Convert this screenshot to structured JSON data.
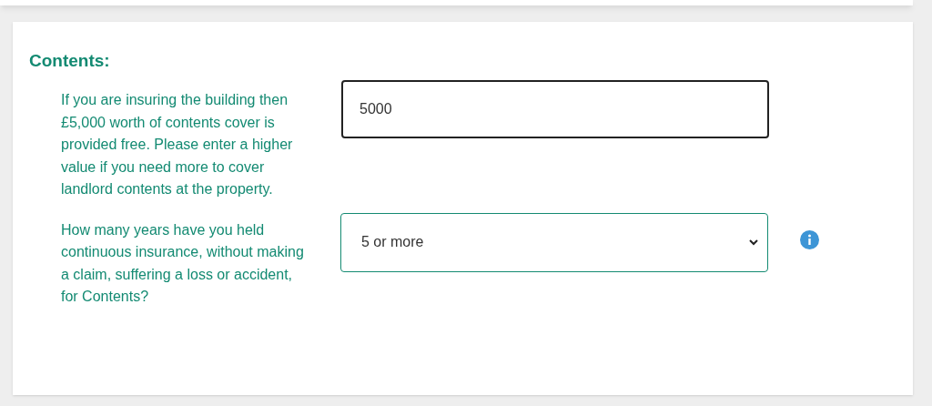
{
  "section": {
    "title": "Contents:"
  },
  "questions": [
    {
      "kind": "text",
      "label": "If you are insuring the building then £5,000 worth of contents cover is provided free. Please enter a higher value if you need more to cover landlord contents at the property.",
      "value": "5000"
    },
    {
      "kind": "select",
      "label": "How many years have you held continuous insurance, without making a claim, suffering a loss or accident, for Contents?",
      "value": "5 or more"
    }
  ]
}
